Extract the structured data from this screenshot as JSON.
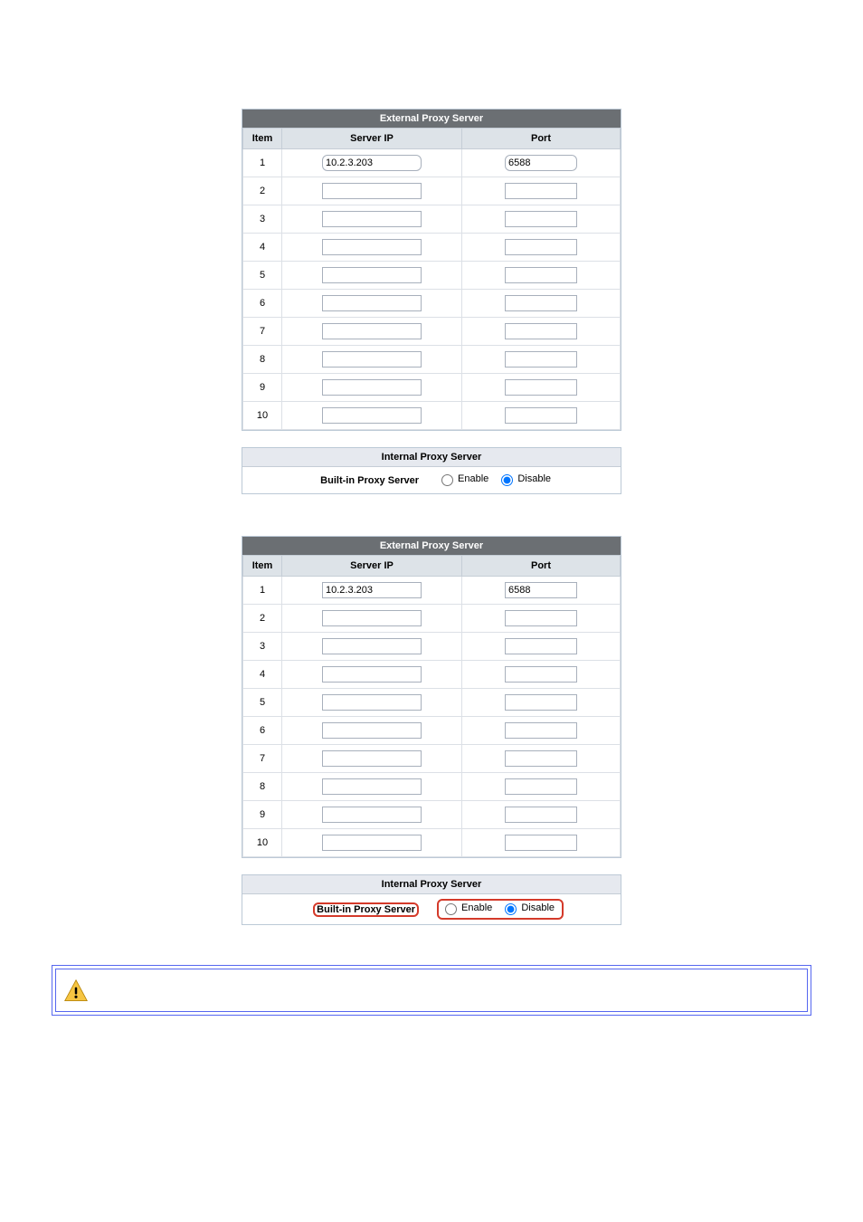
{
  "externalHeader": "External Proxy Server",
  "cols": {
    "item": "Item",
    "server": "Server IP",
    "port": "Port"
  },
  "rows1": [
    {
      "n": "1",
      "ip": "10.2.3.203",
      "port": "6588"
    },
    {
      "n": "2",
      "ip": "",
      "port": ""
    },
    {
      "n": "3",
      "ip": "",
      "port": ""
    },
    {
      "n": "4",
      "ip": "",
      "port": ""
    },
    {
      "n": "5",
      "ip": "",
      "port": ""
    },
    {
      "n": "6",
      "ip": "",
      "port": ""
    },
    {
      "n": "7",
      "ip": "",
      "port": ""
    },
    {
      "n": "8",
      "ip": "",
      "port": ""
    },
    {
      "n": "9",
      "ip": "",
      "port": ""
    },
    {
      "n": "10",
      "ip": "",
      "port": ""
    }
  ],
  "rows2": [
    {
      "n": "1",
      "ip": "10.2.3.203",
      "port": "6588"
    },
    {
      "n": "2",
      "ip": "",
      "port": ""
    },
    {
      "n": "3",
      "ip": "",
      "port": ""
    },
    {
      "n": "4",
      "ip": "",
      "port": ""
    },
    {
      "n": "5",
      "ip": "",
      "port": ""
    },
    {
      "n": "6",
      "ip": "",
      "port": ""
    },
    {
      "n": "7",
      "ip": "",
      "port": ""
    },
    {
      "n": "8",
      "ip": "",
      "port": ""
    },
    {
      "n": "9",
      "ip": "",
      "port": ""
    },
    {
      "n": "10",
      "ip": "",
      "port": ""
    }
  ],
  "internalHeader": "Internal Proxy Server",
  "builtinLabel": "Built-in Proxy Server",
  "enableLabel": "Enable",
  "disableLabel": "Disable",
  "builtinSelected1": "disable",
  "builtinSelected2": "disable"
}
